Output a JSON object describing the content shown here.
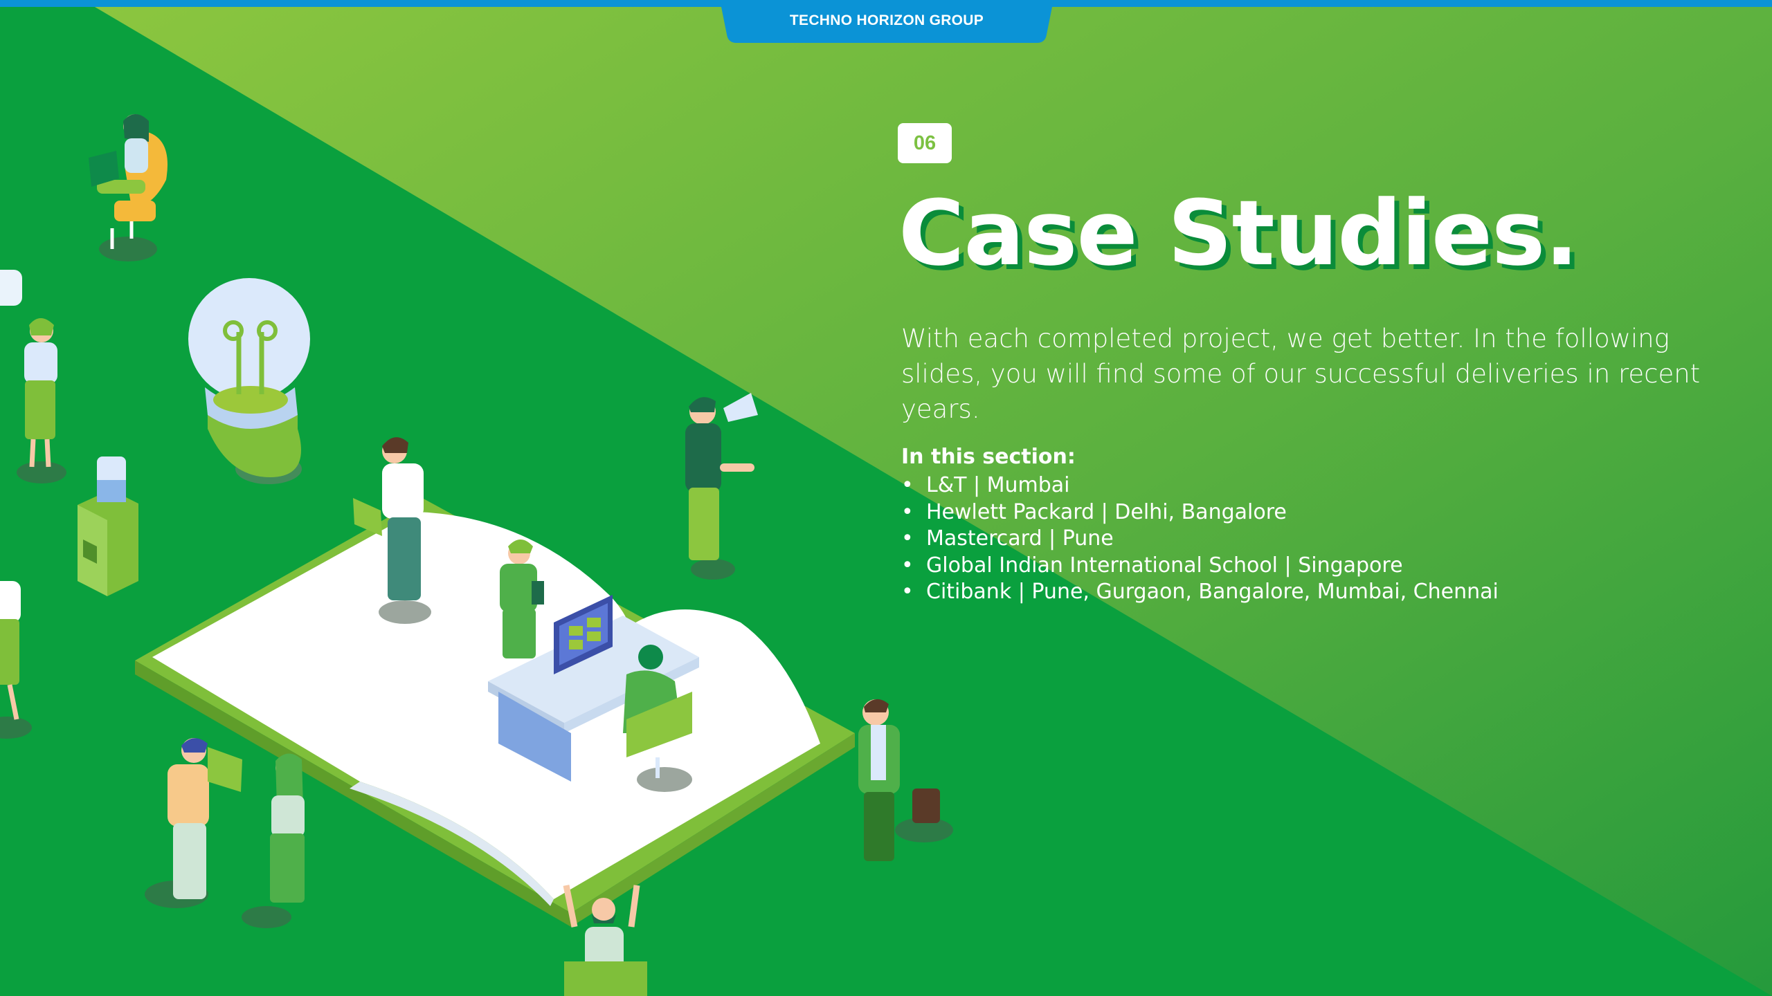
{
  "header": {
    "title": "TECHNO HORIZON GROUP"
  },
  "slide": {
    "number": "06",
    "title": "Case Studies.",
    "intro": "With each completed project, we get better. In the following slides, you will find some of our successful deliveries in recent years.",
    "section_heading": "In this section:",
    "section_items": [
      "L&T | Mumbai",
      "Hewlett Packard | Delhi, Bangalore",
      "Mastercard | Pune",
      "Global Indian International School | Singapore",
      "Citibank | Pune, Gurgaon, Bangalore, Mumbai, Chennai"
    ]
  },
  "colors": {
    "top_bar": "#0b93d6",
    "background_dark_green": "#0aa03e",
    "background_light_green": "#8cc63f",
    "badge_text": "#7cc142",
    "title_shadow": "#0a8c3a"
  },
  "illustration": {
    "icons": [
      "open-book",
      "light-bulb",
      "desk-computer",
      "megaphone",
      "briefcase",
      "laptop",
      "water-cooler"
    ]
  }
}
